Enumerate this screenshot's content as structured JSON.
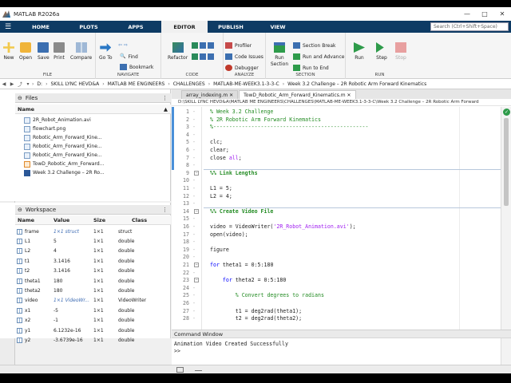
{
  "window": {
    "title": "MATLAB R2026a",
    "min": "—",
    "max": "□",
    "close": "✕"
  },
  "tabs": [
    {
      "label": "HOME"
    },
    {
      "label": "PLOTS"
    },
    {
      "label": "APPS"
    },
    {
      "label": "EDITOR",
      "active": true
    },
    {
      "label": "PUBLISH"
    },
    {
      "label": "VIEW"
    }
  ],
  "search": {
    "placeholder": "Search (Ctrl+Shift+Space)"
  },
  "ribbon": {
    "file": {
      "label": "FILE",
      "new": "New",
      "open": "Open",
      "save": "Save",
      "print": "Print",
      "compare": "Compare"
    },
    "navigate": {
      "label": "NAVIGATE",
      "goto": "Go To",
      "find": "Find",
      "bookmark": "Bookmark"
    },
    "code": {
      "label": "CODE",
      "refactor": "Refactor"
    },
    "analyze": {
      "label": "ANALYZE",
      "profiler": "Profiler",
      "code_issues": "Code Issues",
      "debugger": "Debugger"
    },
    "section": {
      "label": "SECTION",
      "run_section": "Run Section",
      "section_break": "Section Break",
      "run_and_advance": "Run and Advance",
      "run_to_end": "Run to End"
    },
    "run": {
      "label": "RUN",
      "run": "Run",
      "step": "Step",
      "stop": "Stop"
    }
  },
  "address": [
    "D:",
    "SKILL LYNC HEVD&A",
    "MATLAB ME ENGINEERS",
    "CHALLENGES",
    "MATLAB-ME-WEEK3.1-3-3-C",
    "Week 3.2 Challenge – 2R Robotic Arm Forward Kinematics"
  ],
  "files_panel": {
    "title": "Files",
    "col_name": "Name",
    "items": [
      "2R_Robot_Animation.avi",
      "flowchart.png",
      "Robotic_Arm_Forward_Kine...",
      "Robotic_Arm_Forward_Kine...",
      "Robotic_Arm_Forward_Kine...",
      "TowD_Robotic_Arm_Forward...",
      "Week 3.2 Challenge – 2R Ro..."
    ]
  },
  "workspace": {
    "title": "Workspace",
    "cols": {
      "name": "Name",
      "value": "Value",
      "size": "Size",
      "class": "Class"
    },
    "rows": [
      {
        "name": "frame",
        "value": "1×1 struct",
        "size": "1×1",
        "class": "struct",
        "link": true
      },
      {
        "name": "L1",
        "value": "5",
        "size": "1×1",
        "class": "double"
      },
      {
        "name": "L2",
        "value": "4",
        "size": "1×1",
        "class": "double"
      },
      {
        "name": "t1",
        "value": "3.1416",
        "size": "1×1",
        "class": "double"
      },
      {
        "name": "t2",
        "value": "3.1416",
        "size": "1×1",
        "class": "double"
      },
      {
        "name": "theta1",
        "value": "180",
        "size": "1×1",
        "class": "double"
      },
      {
        "name": "theta2",
        "value": "180",
        "size": "1×1",
        "class": "double"
      },
      {
        "name": "video",
        "value": "1×1 VideoWr...",
        "size": "1×1",
        "class": "VideoWriter",
        "link": true
      },
      {
        "name": "x1",
        "value": "-5",
        "size": "1×1",
        "class": "double"
      },
      {
        "name": "x2",
        "value": "-1",
        "size": "1×1",
        "class": "double"
      },
      {
        "name": "y1",
        "value": "6.1232e-16",
        "size": "1×1",
        "class": "double"
      },
      {
        "name": "y2",
        "value": "-3.6739e-16",
        "size": "1×1",
        "class": "double"
      }
    ]
  },
  "editor": {
    "tabs": [
      {
        "label": "array_indexing.m  ✕"
      },
      {
        "label": "TowD_Robotic_Arm_Forward_Kinematics.m  ✕",
        "active": true
      }
    ],
    "path": "D:\\SKILL LYNC HEVD&A\\MATLAB ME ENGINEERS\\CHALLENGES\\MATLAB-ME-WEEK3.1-3-3-C\\Week 3.2 Challenge – 2R Robotic Arm Forward",
    "lines": [
      {
        "n": "1",
        "text": "% Week 3.2 Challenge",
        "cls": "cm"
      },
      {
        "n": "2",
        "text": "% 2R Robotic Arm Forward Kinematics",
        "cls": "cm"
      },
      {
        "n": "3",
        "text": "%-------------------------------------------------",
        "cls": "cm"
      },
      {
        "n": "4",
        "text": "",
        "cls": ""
      },
      {
        "n": "5",
        "text": "clc;",
        "cls": ""
      },
      {
        "n": "6",
        "text": "clear;",
        "cls": ""
      },
      {
        "n": "7",
        "text": "close all;",
        "cls": "kwall"
      },
      {
        "n": "8",
        "text": "",
        "cls": ""
      },
      {
        "n": "9",
        "text": "%% Link Lengths",
        "cls": "cmb"
      },
      {
        "n": "10",
        "text": "",
        "cls": ""
      },
      {
        "n": "11",
        "text": "L1 = 5;",
        "cls": ""
      },
      {
        "n": "12",
        "text": "L2 = 4;",
        "cls": ""
      },
      {
        "n": "13",
        "text": "",
        "cls": ""
      },
      {
        "n": "14",
        "text": "%% Create Video File",
        "cls": "cmb"
      },
      {
        "n": "15",
        "text": "",
        "cls": ""
      },
      {
        "n": "16",
        "text": "video = VideoWriter('2R_Robot_Animation.avi');",
        "cls": "str"
      },
      {
        "n": "17",
        "text": "open(video);",
        "cls": ""
      },
      {
        "n": "18",
        "text": "",
        "cls": ""
      },
      {
        "n": "19",
        "text": "figure",
        "cls": ""
      },
      {
        "n": "20",
        "text": "",
        "cls": ""
      },
      {
        "n": "21",
        "text": "for theta1 = 0:5:180",
        "cls": "for1"
      },
      {
        "n": "22",
        "text": "",
        "cls": ""
      },
      {
        "n": "23",
        "text": "    for theta2 = 0:5:180",
        "cls": "for2"
      },
      {
        "n": "24",
        "text": "",
        "cls": ""
      },
      {
        "n": "25",
        "text": "        % Convert degrees to radians",
        "cls": "cm"
      },
      {
        "n": "26",
        "text": "",
        "cls": ""
      },
      {
        "n": "27",
        "text": "        t1 = deg2rad(theta1);",
        "cls": ""
      },
      {
        "n": "28",
        "text": "        t2 = deg2rad(theta2);",
        "cls": ""
      }
    ]
  },
  "command_window": {
    "title": "Command Window",
    "output": "Animation Video Created Successfully",
    "prompt": ">>"
  }
}
